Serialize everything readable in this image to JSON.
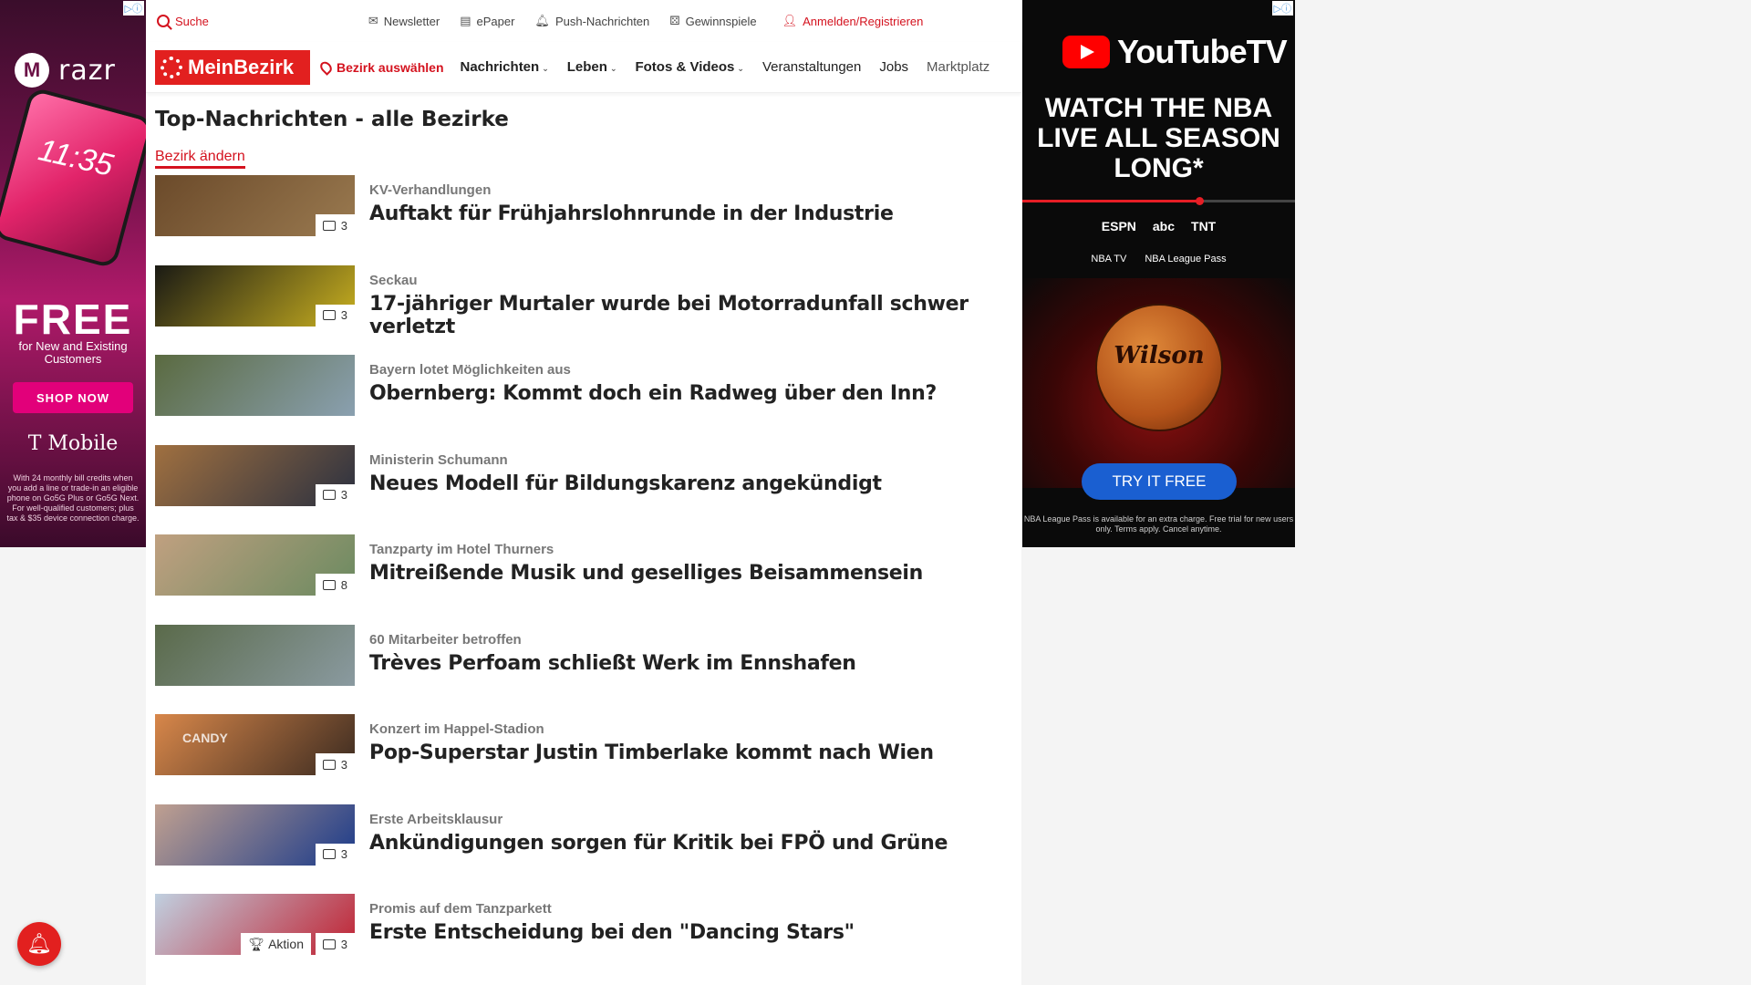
{
  "left_ad": {
    "brand": "razr",
    "clock": "11:35",
    "free": "FREE",
    "free_sub": "for New and Existing Customers",
    "cta": "SHOP NOW",
    "carrier": "T Mobile",
    "fine_print": "With 24 monthly bill credits when you add a line or trade-in an eligible phone on Go5G Plus or Go5G Next. For well-qualified customers; plus tax & $35 device connection charge."
  },
  "right_ad": {
    "logo_text": "YouTubeTV",
    "headline": "WATCH THE NBA LIVE ALL SEASON LONG*",
    "networks": [
      "ESPN",
      "abc",
      "TNT"
    ],
    "networks2": [
      "NBA TV",
      "NBA League Pass"
    ],
    "ball_text": "Wilson",
    "cta": "TRY IT FREE",
    "fine_print": "NBA League Pass is available for an extra charge. Free trial for new users only. Terms apply. Cancel anytime."
  },
  "topbar": {
    "search": "Suche",
    "newsletter": "Newsletter",
    "epaper": "ePaper",
    "push": "Push-Nachrichten",
    "gewinnspiele": "Gewinnspiele",
    "login": "Anmelden/Registrieren"
  },
  "nav": {
    "logo": "MeinBezirk",
    "bezirk": "Bezirk auswählen",
    "links": [
      "Nachrichten",
      "Leben",
      "Fotos & Videos",
      "Veranstaltungen",
      "Jobs",
      "Marktplatz"
    ]
  },
  "page": {
    "title": "Top-Nachrichten - alle Bezirke",
    "change_bezirk": "Bezirk ändern"
  },
  "articles": [
    {
      "kicker": "KV-Verhandlungen",
      "headline": "Auftakt für Frühjahrslohnrunde in der Industrie",
      "photos": "3",
      "colors": [
        "#6b4a2a",
        "#9a7a50"
      ]
    },
    {
      "kicker": "Seckau",
      "headline": "17-jähriger Murtaler wurde bei Motorradunfall schwer verletzt",
      "photos": "3",
      "colors": [
        "#1a1a14",
        "#c9b020"
      ]
    },
    {
      "kicker": "Bayern lotet Möglichkeiten aus",
      "headline": "Obernberg: Kommt doch ein Radweg über den Inn?",
      "photos": "",
      "colors": [
        "#5a6a40",
        "#8aa0b0"
      ]
    },
    {
      "kicker": "Ministerin Schumann",
      "headline": "Neues Modell für Bildungskarenz angekündigt",
      "photos": "3",
      "colors": [
        "#a07040",
        "#2a3040"
      ]
    },
    {
      "kicker": "Tanzparty im Hotel Thurners",
      "headline": "Mitreißende Musik und geselliges Beisammensein",
      "photos": "8",
      "colors": [
        "#c0a080",
        "#6a8a60"
      ]
    },
    {
      "kicker": "60 Mitarbeiter betroffen",
      "headline": "Trèves Perfoam schließt Werk im Ennshafen",
      "photos": "",
      "colors": [
        "#5a6a4a",
        "#8a9aa0"
      ]
    },
    {
      "kicker": "Konzert im Happel-Stadion",
      "headline": "Pop-Superstar Justin Timberlake kommt nach Wien",
      "photos": "3",
      "colors": [
        "#d8874a",
        "#3a2a20"
      ],
      "badge_text": "CANDY"
    },
    {
      "kicker": "Erste Arbeitsklausur",
      "headline": "Ankündigungen sorgen für Kritik bei FPÖ und Grüne",
      "photos": "3",
      "colors": [
        "#c0a090",
        "#1a3a8a"
      ]
    },
    {
      "kicker": "Promis auf dem Tanzparkett",
      "headline": "Erste Entscheidung bei den \"Dancing Stars\"",
      "photos": "3",
      "aktion": "Aktion",
      "colors": [
        "#c0d0e0",
        "#c02030"
      ]
    }
  ]
}
